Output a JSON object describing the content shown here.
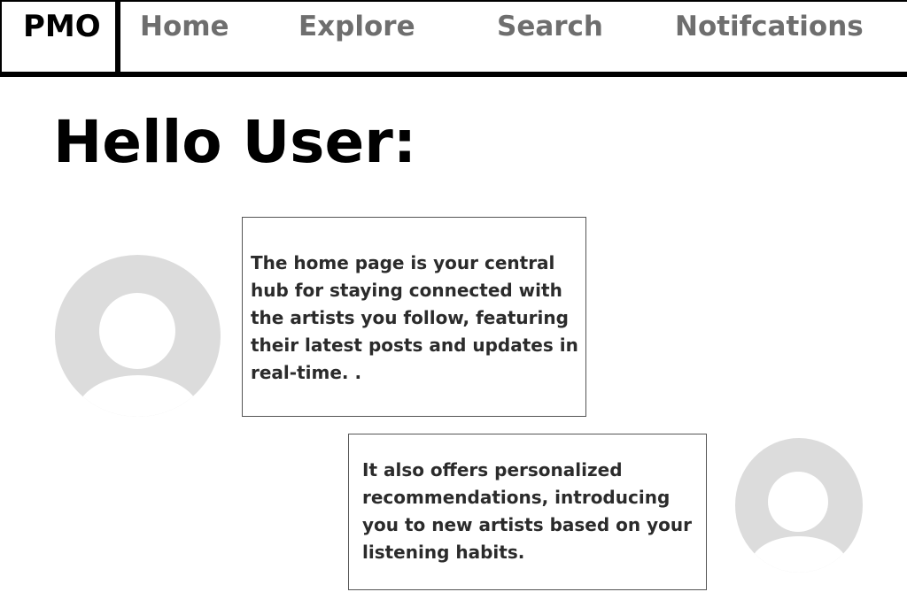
{
  "nav": {
    "brand": "PMO",
    "links": [
      "Home",
      "Explore",
      "Search",
      "Notifcations"
    ]
  },
  "greeting": "Hello User:",
  "cards": [
    {
      "text": "The home page is your central hub for staying connected with the artists you follow, featuring their latest posts and updates in real-time. ."
    },
    {
      "text": "It also offers personalized recommendations, introducing you to new artists based on your listening habits."
    }
  ],
  "icons": {
    "avatar": "user-placeholder-icon"
  },
  "colors": {
    "nav_link": "#6e6e6e",
    "avatar_bg": "#dcdcdc",
    "text": "#2b2b2b"
  }
}
